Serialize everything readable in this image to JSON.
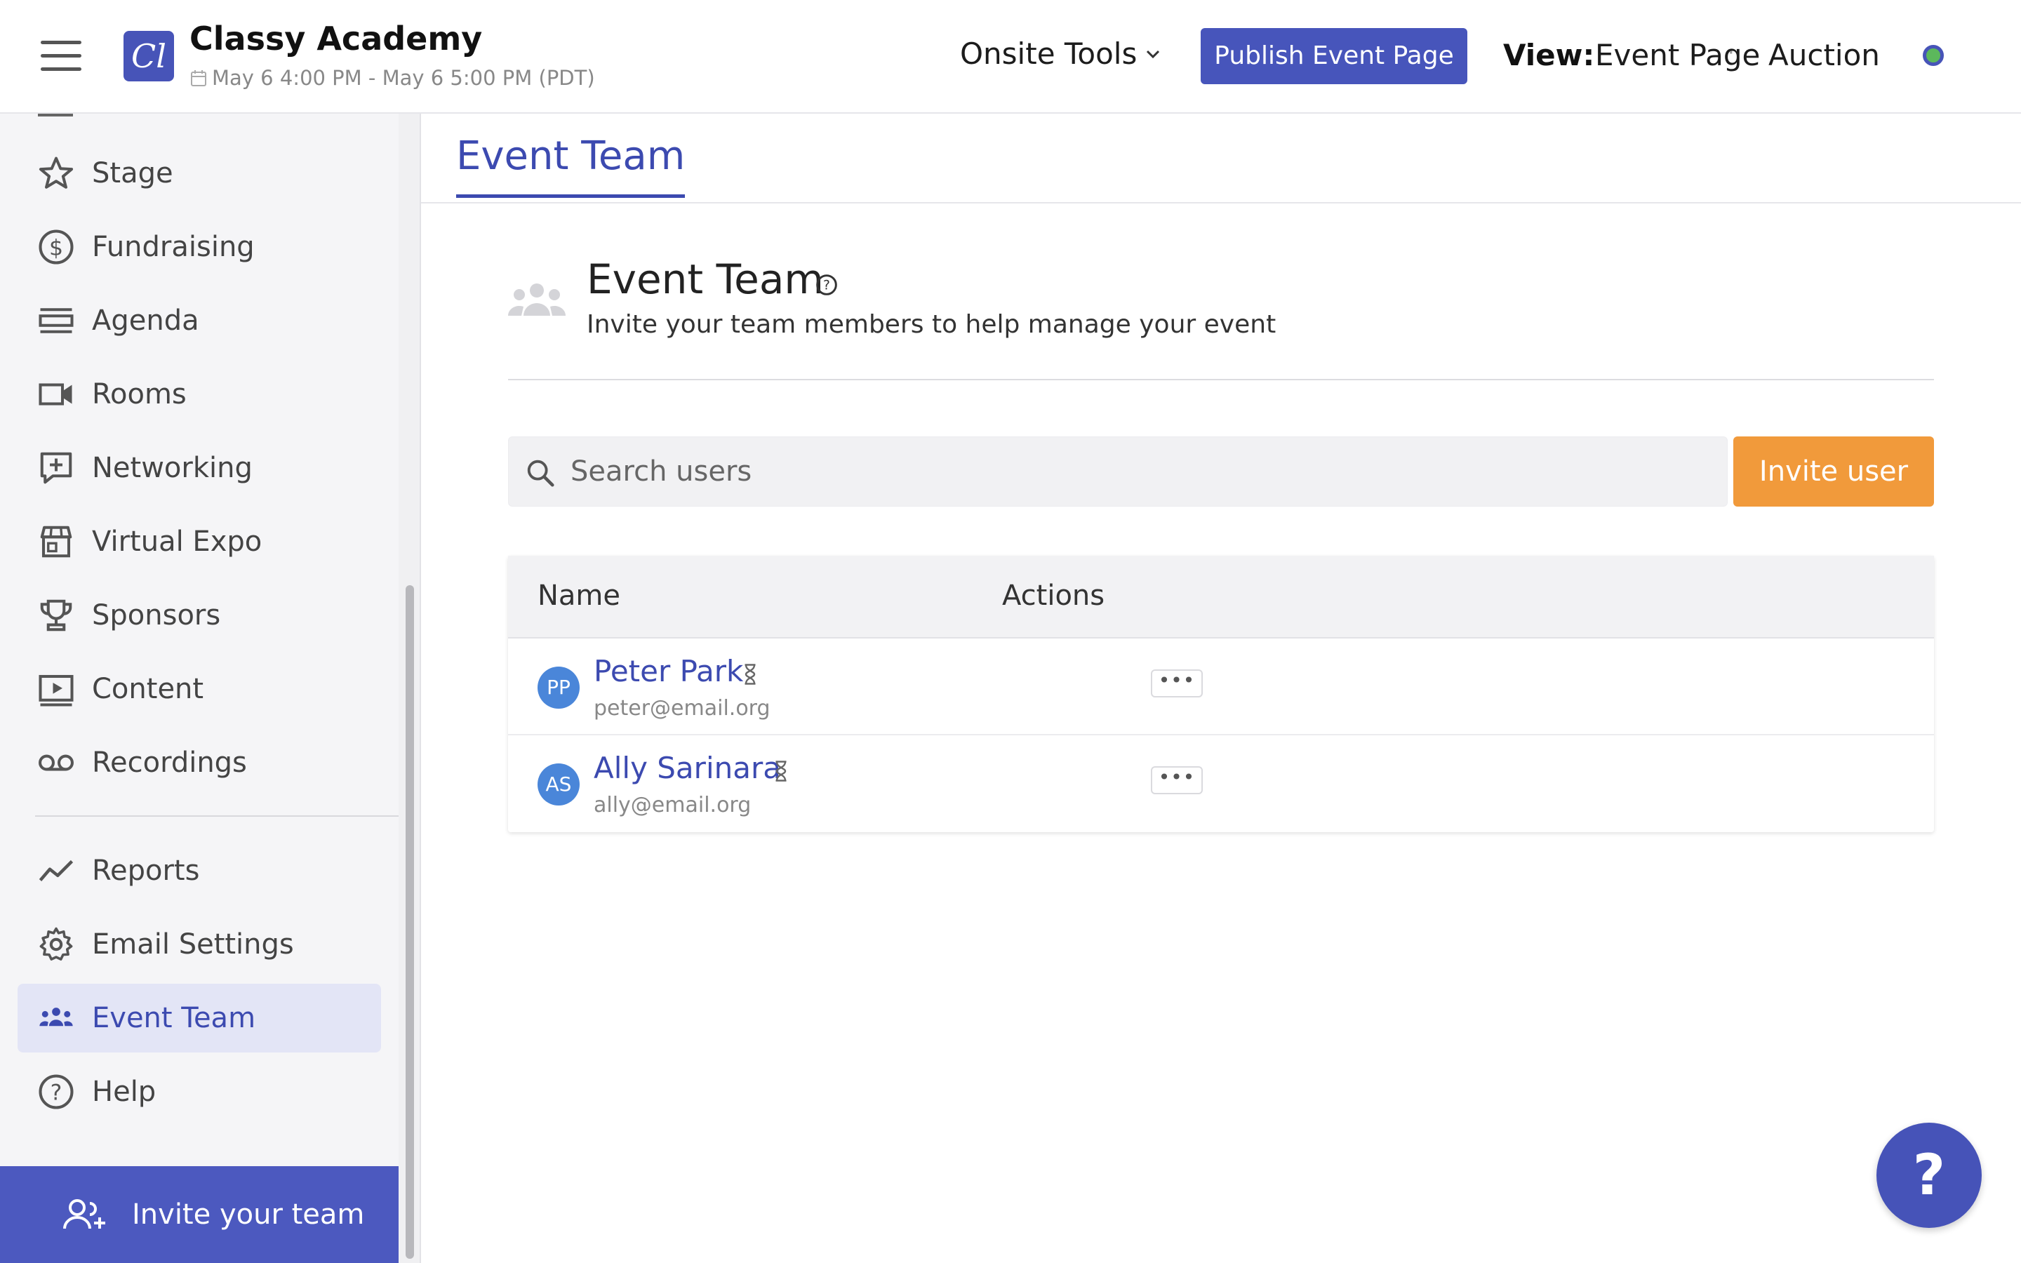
{
  "header": {
    "logo_text": "Cl",
    "org_name": "Classy Academy",
    "event_dates": "May 6 4:00 PM - May 6 5:00 PM (PDT)",
    "onsite_tools_label": "Onsite Tools",
    "publish_label": "Publish Event Page",
    "view_label": "View:",
    "view_options": [
      "Event Page",
      "Auction"
    ],
    "view_separator": "·",
    "status_color": "#5cb85c"
  },
  "sidebar": {
    "items": [
      {
        "label": "Stage",
        "icon": "star-icon"
      },
      {
        "label": "Fundraising",
        "icon": "dollar-circle-icon"
      },
      {
        "label": "Agenda",
        "icon": "agenda-icon"
      },
      {
        "label": "Rooms",
        "icon": "video-camera-icon"
      },
      {
        "label": "Networking",
        "icon": "networking-icon"
      },
      {
        "label": "Virtual Expo",
        "icon": "storefront-icon"
      },
      {
        "label": "Sponsors",
        "icon": "trophy-icon"
      },
      {
        "label": "Content",
        "icon": "play-screen-icon"
      },
      {
        "label": "Recordings",
        "icon": "voicemail-icon"
      }
    ],
    "secondary_items": [
      {
        "label": "Reports",
        "icon": "trend-line-icon"
      },
      {
        "label": "Email Settings",
        "icon": "gear-icon"
      },
      {
        "label": "Event Team",
        "icon": "team-icon",
        "active": true
      },
      {
        "label": "Help",
        "icon": "help-circle-icon"
      }
    ],
    "invite_team_label": "Invite your team"
  },
  "main": {
    "tab_label": "Event Team",
    "section_title": "Event Team",
    "section_subtitle": "Invite your team members to help manage your event",
    "search": {
      "placeholder": "Search users",
      "value": ""
    },
    "invite_button": "Invite user",
    "table": {
      "columns": [
        "Name",
        "Actions"
      ],
      "rows": [
        {
          "initials": "PP",
          "name": "Peter Park",
          "email": "peter@email.org",
          "actions": "•••"
        },
        {
          "initials": "AS",
          "name": "Ally Sarinara",
          "email": "ally@email.org",
          "actions": "•••"
        }
      ]
    },
    "help_fab": "?"
  },
  "colors": {
    "brand": "#4755bb",
    "accent_orange": "#f19a3b",
    "active_nav_bg": "#e3e5f6"
  }
}
